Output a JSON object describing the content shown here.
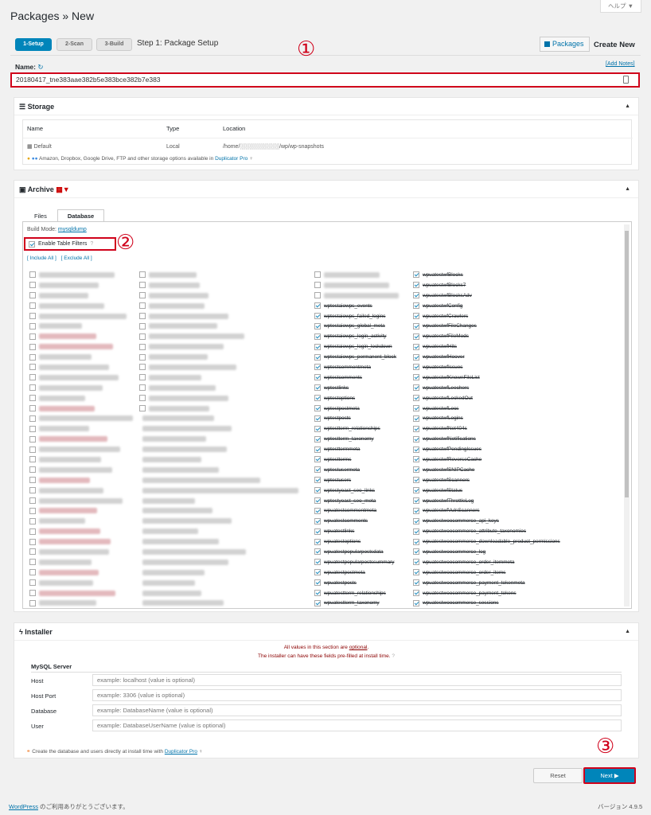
{
  "page": {
    "title": "Packages » New",
    "help_label": "ヘルプ ▼"
  },
  "steps": [
    {
      "label": "1-Setup"
    },
    {
      "label": "2-Scan"
    },
    {
      "label": "3-Build"
    }
  ],
  "step_title": "Step 1: Package Setup",
  "header_actions": {
    "packages": "Packages",
    "create_new": "Create New"
  },
  "annotations": {
    "n1": "①",
    "n2": "②",
    "n3": "③"
  },
  "name": {
    "label": "Name:",
    "value": "20180417_tne383aae382b5e383bce382b7e383",
    "add_notes": "[Add Notes]"
  },
  "storage": {
    "title": "Storage",
    "headers": [
      "Name",
      "Type",
      "Location"
    ],
    "row": {
      "name": "Default",
      "type": "Local",
      "location": "/home/░░░░░░░░░░/wp/wp-snapshots"
    },
    "note": "Amazon, Dropbox, Google Drive, FTP and other storage options available in",
    "note_link": "Duplicator Pro"
  },
  "archive": {
    "title": "Archive",
    "tabs": [
      "Files",
      "Database"
    ],
    "build_mode_label": "Build Mode:",
    "build_mode_value": "mysqldump",
    "enable_filters": "Enable Table Filters",
    "include_all": "[ Include All ]",
    "exclude_all": "[ Exclude All ]",
    "col3_names": [
      "",
      "",
      "",
      "wptestaiowps_events",
      "wptestaiowps_failed_logins",
      "wptestaiowps_global_meta",
      "wptestaiowps_login_activity",
      "wptestaiowps_login_lockdown",
      "wptestaiowps_permanent_block",
      "wptestcommentmeta",
      "wptestcomments",
      "wptestlinks",
      "wptestoptions",
      "wptestpostmeta",
      "wptestposts",
      "wptestterm_relationships",
      "wptestterm_taxonomy",
      "wptesttermmeta",
      "wptestterms",
      "wptestusermeta",
      "wptestusers",
      "wptestyoast_seo_links",
      "wptestyoast_seo_meta",
      "wpuatestcommentmeta",
      "wpuatestcomments",
      "wpuatestlinks",
      "wpuatestoptions",
      "wpuatestpopularpostsdata",
      "wpuatestpopularpostssummary",
      "wpuatestpostmeta",
      "wpuatestposts",
      "wpuatestterm_relationships",
      "wpuatestterm_taxonomy",
      "wpuatesttermmeta"
    ],
    "col4_names": [
      "wpuatestwfBlocks",
      "wpuatestwfBlocks7",
      "wpuatestwfBlocksAdv",
      "wpuatestwfConfig",
      "wpuatestwfCrawlers",
      "wpuatestwfFileChanges",
      "wpuatestwfFileMods",
      "wpuatestwfHits",
      "wpuatestwfHoover",
      "wpuatestwfIssues",
      "wpuatestwfKnownFileList",
      "wpuatestwfLeechers",
      "wpuatestwfLockedOut",
      "wpuatestwfLocs",
      "wpuatestwfLogins",
      "wpuatestwfNet404s",
      "wpuatestwfNotifications",
      "wpuatestwfPendingIssues",
      "wpuatestwfReverseCache",
      "wpuatestwfSNIPCache",
      "wpuatestwfScanners",
      "wpuatestwfStatus",
      "wpuatestwfThrottleLog",
      "wpuatestwfVulnScanners",
      "wpuatestwoocommerce_api_keys",
      "wpuatestwoocommerce_attribute_taxonomies",
      "wpuatestwoocommerce_downloadable_product_permissions",
      "wpuatestwoocommerce_log",
      "wpuatestwoocommerce_order_itemmeta",
      "wpuatestwoocommerce_order_items",
      "wpuatestwoocommerce_payment_tokenmeta",
      "wpuatestwoocommerce_payment_tokens",
      "wpuatestwoocommerce_sessions",
      "wpuatestwoocommerce_shipping_zone_locations"
    ]
  },
  "installer": {
    "title": "Installer",
    "optional_note_pre": "All values in this section are ",
    "optional_word": "optional",
    "optional_note_post": ".",
    "prefill_note": "The installer can have these fields pre-filled at install time.",
    "mysql_header": "MySQL Server",
    "fields": [
      {
        "label": "Host",
        "placeholder": "example: localhost (value is optional)"
      },
      {
        "label": "Host Port",
        "placeholder": "example: 3306 (value is optional)"
      },
      {
        "label": "Database",
        "placeholder": "example: DatabaseName (value is optional)"
      },
      {
        "label": "User",
        "placeholder": "example: DatabaseUserName (value is optional)"
      }
    ],
    "pro_note": "Create the database and users directly at install time with",
    "pro_link": "Duplicator Pro"
  },
  "buttons": {
    "reset": "Reset",
    "next": "Next ▶"
  },
  "footer": {
    "wp_link": "WordPress",
    "thanks": " のご利用ありがとうございます。",
    "version": "バージョン 4.9.5"
  }
}
